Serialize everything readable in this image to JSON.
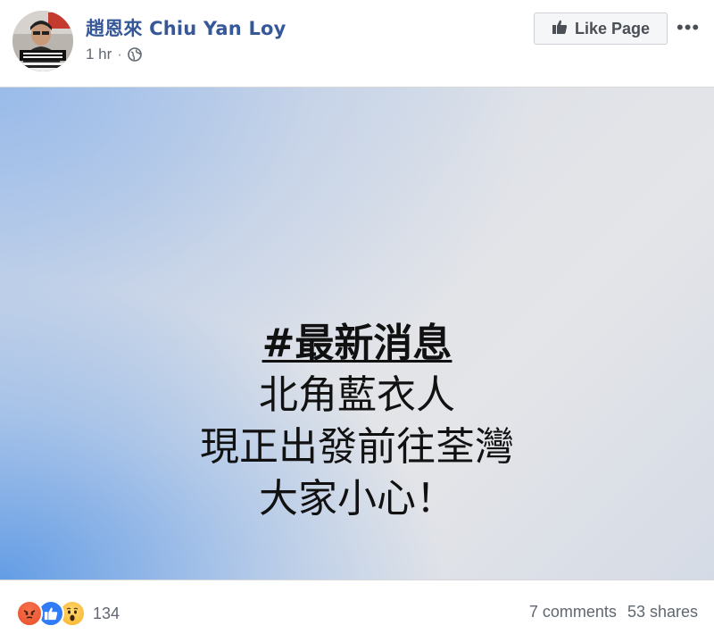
{
  "post": {
    "page_name": "趙恩來 Chiu Yan Loy",
    "time": "1 hr",
    "separator": "·",
    "like_page_label": "Like Page",
    "more_label": "•••",
    "image_text": {
      "headline": "#最新消息",
      "line2": "北角藍衣人",
      "line3": "現正出發前往荃灣",
      "line4": "大家小心！"
    }
  },
  "engagement": {
    "reaction_icons": [
      "angry-icon",
      "like-icon",
      "wow-icon"
    ],
    "reaction_count": "134",
    "comments": "7 comments",
    "shares": "53 shares"
  },
  "colors": {
    "page_name": "#365899",
    "meta_text": "#606770",
    "like_blue": "#2f7cf6",
    "angry_orange": "#e9502b",
    "wow_yellow": "#f7b125"
  }
}
